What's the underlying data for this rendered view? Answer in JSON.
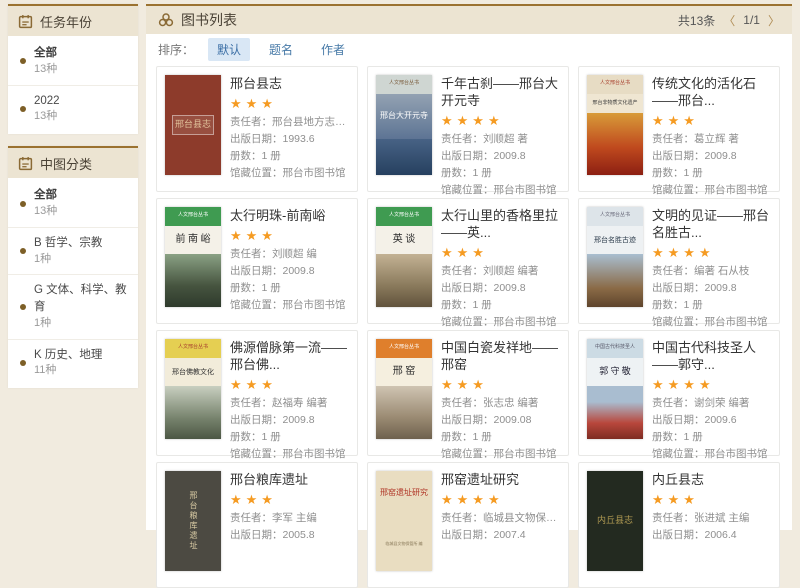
{
  "colors": {
    "accent_gold": "#9b7230",
    "panel_header_bg": "#ece4d2",
    "star_orange": "#f59b22",
    "link_blue": "#4679a7",
    "sort_active_bg": "#d9e7f5",
    "page_bg": "#f1ebdf"
  },
  "sidebar": {
    "sections": [
      {
        "title": "任务年份",
        "items": [
          {
            "label": "全部",
            "count": "13种",
            "active": true
          },
          {
            "label": "2022",
            "count": "13种",
            "active": false
          }
        ]
      },
      {
        "title": "中图分类",
        "items": [
          {
            "label": "全部",
            "count": "13种",
            "active": true
          },
          {
            "label": "B 哲学、宗教",
            "count": "1种",
            "active": false
          },
          {
            "label": "G 文体、科学、教育",
            "count": "1种",
            "active": false
          },
          {
            "label": "K 历史、地理",
            "count": "11种",
            "active": false
          }
        ]
      }
    ]
  },
  "header": {
    "title": "图书列表",
    "total": "共13条",
    "prev_label": "〈",
    "page_indicator": "1/1",
    "next_label": "〉"
  },
  "sort": {
    "label": "排序：",
    "options": [
      {
        "label": "默认",
        "active": true
      },
      {
        "label": "题名",
        "active": false
      },
      {
        "label": "作者",
        "active": false
      }
    ]
  },
  "books": [
    {
      "title": "邢台县志",
      "stars": 3,
      "meta": [
        {
          "label": "责任者：",
          "value": "邢台县地方志编纂委..."
        },
        {
          "label": "出版日期：",
          "value": "1993.6"
        },
        {
          "label": "册数：",
          "value": "1 册"
        },
        {
          "label": "馆藏位置：",
          "value": "邢台市图书馆"
        }
      ],
      "cover": {
        "segments": [
          {
            "f": 1,
            "bg": "#8d3b2b",
            "text": "邢台县志",
            "color": "#e2c49c",
            "fs": 9,
            "box": true
          }
        ]
      }
    },
    {
      "title": "千年古刹——邢台大开元寺",
      "stars": 4,
      "meta": [
        {
          "label": "责任者：",
          "value": "刘顺超 著"
        },
        {
          "label": "出版日期：",
          "value": "2009.8"
        },
        {
          "label": "册数：",
          "value": "1 册"
        },
        {
          "label": "馆藏位置：",
          "value": "邢台市图书馆"
        }
      ],
      "cover": {
        "segments": [
          {
            "f": 2,
            "bg": "#cfd6d2",
            "text": "人文邢台丛书",
            "color": "#7a5b3a",
            "fs": 5
          },
          {
            "f": 5,
            "bg": "linear-gradient(180deg,#93a2b2,#5d7494)",
            "text": "邢台大开元寺",
            "color": "#fdfdfd",
            "fs": 8
          },
          {
            "f": 4,
            "bg": "linear-gradient(180deg,#476285,#26405f)",
            "text": "",
            "color": "#fff",
            "fs": 5
          }
        ]
      }
    },
    {
      "title": "传统文化的活化石——邢台...",
      "stars": 3,
      "meta": [
        {
          "label": "责任者：",
          "value": "葛立辉 著"
        },
        {
          "label": "出版日期：",
          "value": "2009.8"
        },
        {
          "label": "册数：",
          "value": "1 册"
        },
        {
          "label": "馆藏位置：",
          "value": "邢台市图书馆"
        }
      ],
      "cover": {
        "segments": [
          {
            "f": 2,
            "bg": "#e7dcc4",
            "text": "人文邢台丛书",
            "color": "#a8402e",
            "fs": 5
          },
          {
            "f": 2,
            "bg": "#efe6d2",
            "text": "邢台非物质文化遗产",
            "color": "#3a3a3a",
            "fs": 5
          },
          {
            "f": 7,
            "bg": "linear-gradient(180deg,#d89b39,#c04a1e 55%,#8c1f12)",
            "text": "",
            "color": "#fff",
            "fs": 5
          }
        ]
      }
    },
    {
      "title": "太行明珠-前南峪",
      "stars": 3,
      "meta": [
        {
          "label": "责任者：",
          "value": "刘顺超 编"
        },
        {
          "label": "出版日期：",
          "value": "2009.8"
        },
        {
          "label": "册数：",
          "value": "1 册"
        },
        {
          "label": "馆藏位置：",
          "value": "邢台市图书馆"
        }
      ],
      "cover": {
        "segments": [
          {
            "f": 2,
            "bg": "#3f9b51",
            "text": "人文邢台丛书",
            "color": "#ffffff",
            "fs": 5
          },
          {
            "f": 3,
            "bg": "#f4f1e8",
            "text": "前 南 峪",
            "color": "#2b2b2b",
            "fs": 10
          },
          {
            "f": 6,
            "bg": "linear-gradient(180deg,#8aa184,#46543f 60%,#2e3a2c)",
            "text": "",
            "color": "#fff",
            "fs": 5
          }
        ]
      }
    },
    {
      "title": "太行山里的香格里拉——英...",
      "stars": 3,
      "meta": [
        {
          "label": "责任者：",
          "value": "刘顺超 编著"
        },
        {
          "label": "出版日期：",
          "value": "2009.8"
        },
        {
          "label": "册数：",
          "value": "1 册"
        },
        {
          "label": "馆藏位置：",
          "value": "邢台市图书馆"
        }
      ],
      "cover": {
        "segments": [
          {
            "f": 2,
            "bg": "#3f9b51",
            "text": "人文邢台丛书",
            "color": "#ffffff",
            "fs": 5
          },
          {
            "f": 3,
            "bg": "#f4f1e8",
            "text": "英 谈",
            "color": "#2b2b2b",
            "fs": 10
          },
          {
            "f": 6,
            "bg": "linear-gradient(180deg,#c3b294,#8a7a5c 60%,#60523c)",
            "text": "",
            "color": "#fff",
            "fs": 5
          }
        ]
      }
    },
    {
      "title": "文明的见证——邢台名胜古...",
      "stars": 4,
      "meta": [
        {
          "label": "责任者：",
          "value": "编著 石从枝"
        },
        {
          "label": "出版日期：",
          "value": "2009.8"
        },
        {
          "label": "册数：",
          "value": "1 册"
        },
        {
          "label": "馆藏位置：",
          "value": "邢台市图书馆"
        }
      ],
      "cover": {
        "segments": [
          {
            "f": 2,
            "bg": "#dde4e9",
            "text": "人文邢台丛书",
            "color": "#666677",
            "fs": 5
          },
          {
            "f": 3,
            "bg": "#eef1f3",
            "text": "邢台名胜古迹",
            "color": "#2b3a4a",
            "fs": 7
          },
          {
            "f": 6,
            "bg": "linear-gradient(180deg,#a9bed0,#8a6a46 65%,#5e442c)",
            "text": "",
            "color": "#fff",
            "fs": 5
          }
        ]
      }
    },
    {
      "title": "佛源僧脉第一流——邢台佛...",
      "stars": 3,
      "meta": [
        {
          "label": "责任者：",
          "value": "赵福寿 编著"
        },
        {
          "label": "出版日期：",
          "value": "2009.8"
        },
        {
          "label": "册数：",
          "value": "1 册"
        },
        {
          "label": "馆藏位置：",
          "value": "邢台市图书馆"
        }
      ],
      "cover": {
        "segments": [
          {
            "f": 2,
            "bg": "#e5cf52",
            "text": "人文邢台丛书",
            "color": "#a8402e",
            "fs": 5
          },
          {
            "f": 3,
            "bg": "#f2ecda",
            "text": "邢台佛教文化",
            "color": "#333333",
            "fs": 7
          },
          {
            "f": 6,
            "bg": "linear-gradient(180deg,#c8cfc0,#78846e 60%,#4c5744)",
            "text": "",
            "color": "#fff",
            "fs": 5
          }
        ]
      }
    },
    {
      "title": "中国白瓷发祥地——邢窑",
      "stars": 3,
      "meta": [
        {
          "label": "责任者：",
          "value": "张志忠 编著"
        },
        {
          "label": "出版日期：",
          "value": "2009.08"
        },
        {
          "label": "册数：",
          "value": "1 册"
        },
        {
          "label": "馆藏位置：",
          "value": "邢台市图书馆"
        }
      ],
      "cover": {
        "segments": [
          {
            "f": 2,
            "bg": "#df7f2c",
            "text": "人文邢台丛书",
            "color": "#ffffff",
            "fs": 5
          },
          {
            "f": 3,
            "bg": "#f5efdf",
            "text": "邢 窑",
            "color": "#2b2b2b",
            "fs": 10
          },
          {
            "f": 6,
            "bg": "linear-gradient(180deg,#cfc4b2,#9a8a72 60%,#6e614e)",
            "text": "",
            "color": "#fff",
            "fs": 5
          }
        ]
      }
    },
    {
      "title": "中国古代科技圣人——郭守...",
      "stars": 4,
      "meta": [
        {
          "label": "责任者：",
          "value": "谢剑荣 编著"
        },
        {
          "label": "出版日期：",
          "value": "2009.6"
        },
        {
          "label": "册数：",
          "value": "1 册"
        },
        {
          "label": "馆藏位置：",
          "value": "邢台市图书馆"
        }
      ],
      "cover": {
        "segments": [
          {
            "f": 2,
            "bg": "#ccdbe4",
            "text": "中国古代科技圣人",
            "color": "#555566",
            "fs": 5
          },
          {
            "f": 3,
            "bg": "#eef2f4",
            "text": "郭 守 敬",
            "color": "#222233",
            "fs": 9
          },
          {
            "f": 6,
            "bg": "linear-gradient(180deg,#a9bdd0 30%,#b8473c 70%,#7e2c22)",
            "text": "",
            "color": "#fff",
            "fs": 5
          }
        ]
      }
    },
    {
      "title": "邢台粮库遗址",
      "stars": 3,
      "meta": [
        {
          "label": "责任者：",
          "value": "李军 主编"
        },
        {
          "label": "出版日期：",
          "value": "2005.8"
        }
      ],
      "cover": {
        "segments": [
          {
            "f": 1,
            "bg": "#4c4a42",
            "text": "邢台粮库遗址",
            "color": "#d9cba4",
            "fs": 8,
            "vertical": true
          }
        ]
      }
    },
    {
      "title": "邢窑遗址研究",
      "stars": 4,
      "meta": [
        {
          "label": "责任者：",
          "value": "临城县文物保管所 ..."
        },
        {
          "label": "出版日期：",
          "value": "2007.4"
        }
      ],
      "cover": {
        "segments": [
          {
            "f": 4,
            "bg": "#e9ddc1",
            "text": "邢窑遗址研究",
            "color": "#b03425",
            "fs": 8
          },
          {
            "f": 5,
            "bg": "#e9ddc1",
            "text": "临城县文物保管所 编",
            "color": "#8a7a5a",
            "fs": 4
          }
        ]
      }
    },
    {
      "title": "内丘县志",
      "stars": 3,
      "meta": [
        {
          "label": "责任者：",
          "value": "张进斌 主编"
        },
        {
          "label": "出版日期：",
          "value": "2006.4"
        }
      ],
      "cover": {
        "segments": [
          {
            "f": 1,
            "bg": "#232a20",
            "text": "内丘县志",
            "color": "#b09a52",
            "fs": 9
          }
        ]
      }
    }
  ]
}
